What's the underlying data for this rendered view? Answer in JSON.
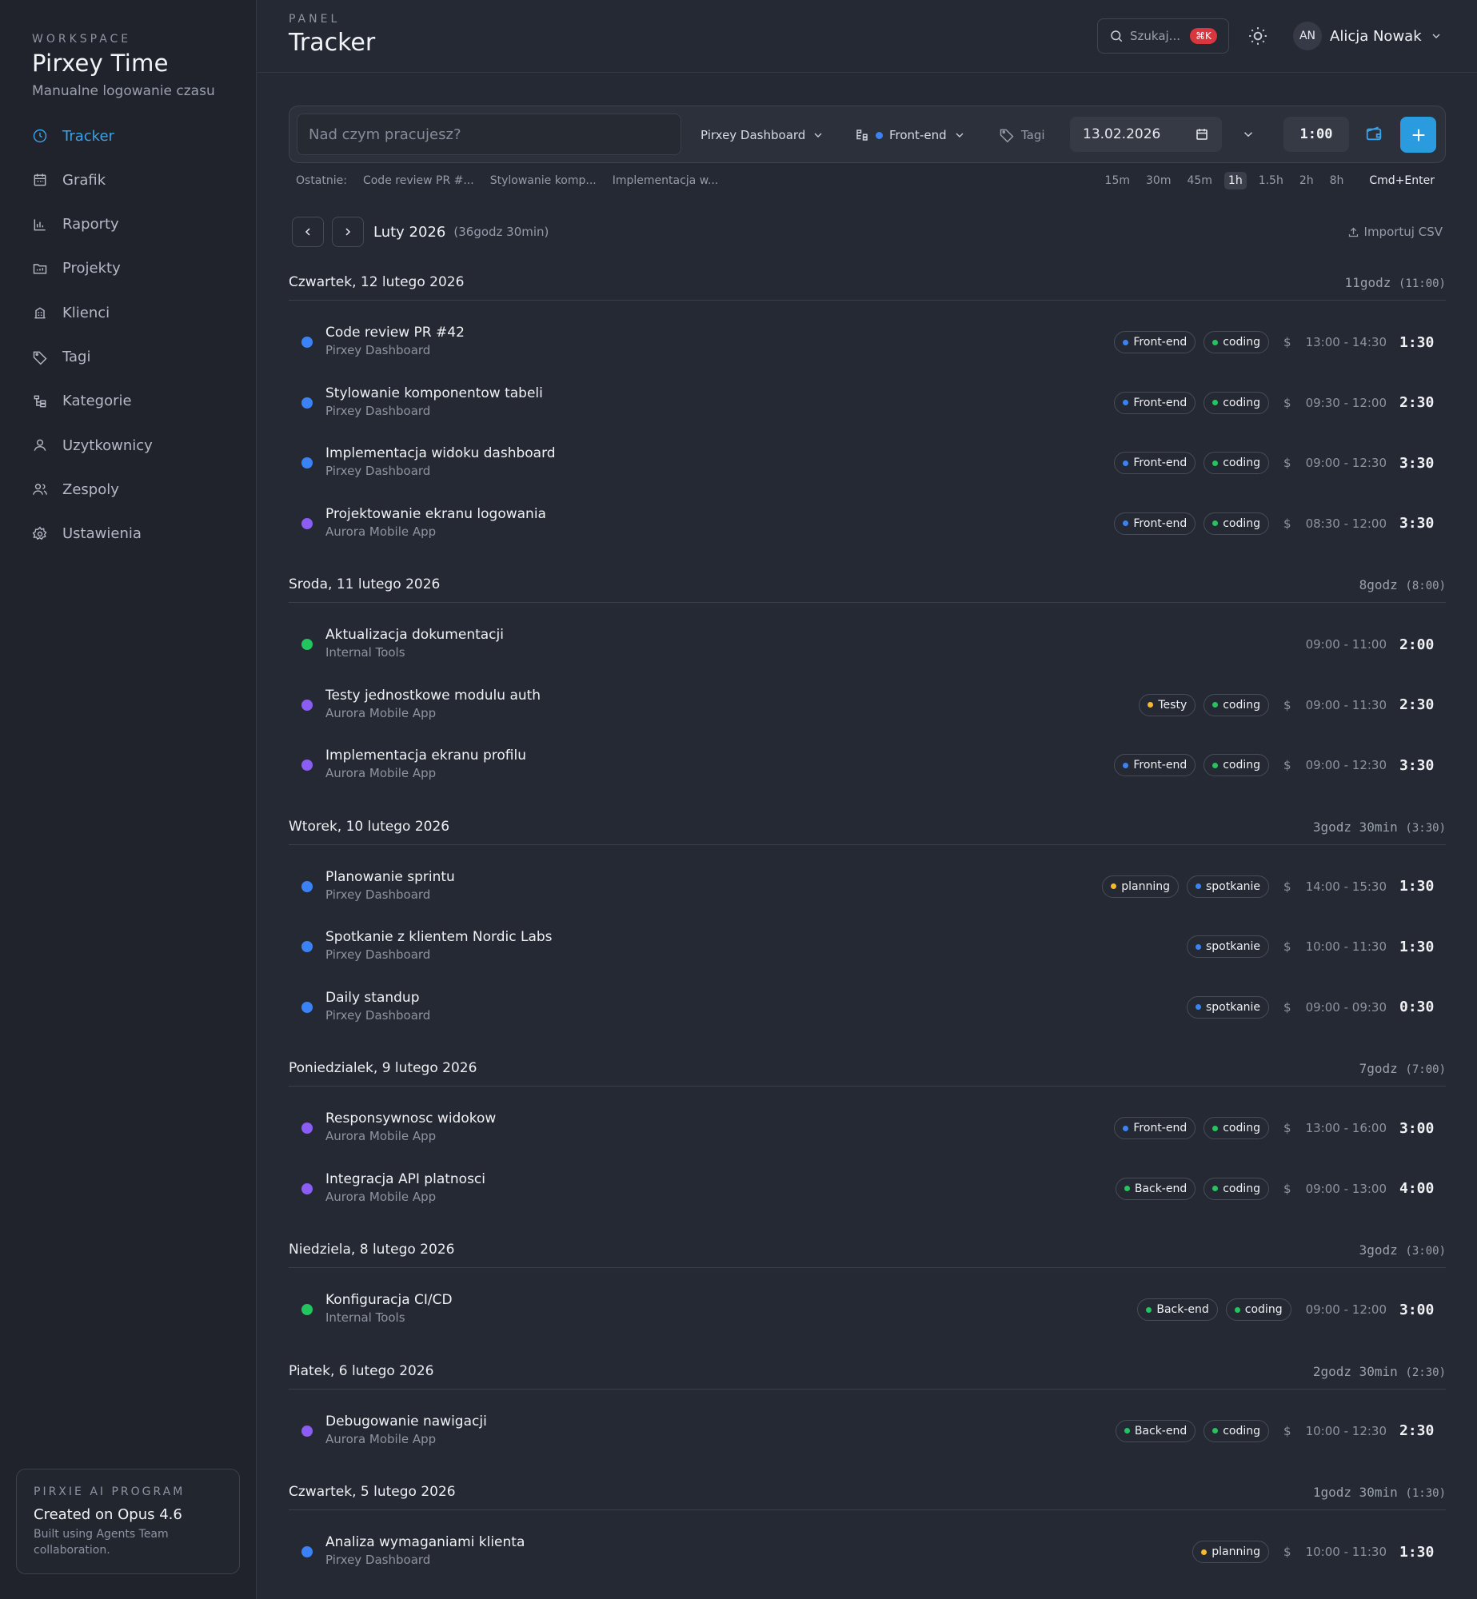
{
  "sidebar": {
    "workspace_label": "WORKSPACE",
    "workspace_name": "Pirxey Time",
    "workspace_sub": "Manualne logowanie czasu",
    "items": [
      {
        "label": "Tracker",
        "icon": "clock-icon",
        "active": true
      },
      {
        "label": "Grafik",
        "icon": "calendar-icon"
      },
      {
        "label": "Raporty",
        "icon": "chart-icon"
      },
      {
        "label": "Projekty",
        "icon": "folder-icon"
      },
      {
        "label": "Klienci",
        "icon": "building-icon"
      },
      {
        "label": "Tagi",
        "icon": "tags-icon"
      },
      {
        "label": "Kategorie",
        "icon": "hierarchy-icon"
      },
      {
        "label": "Uzytkownicy",
        "icon": "user-icon"
      },
      {
        "label": "Zespoly",
        "icon": "team-icon"
      },
      {
        "label": "Ustawienia",
        "icon": "gear-icon"
      }
    ],
    "promo": {
      "label": "PIRXIE AI PROGRAM",
      "title": "Created on Opus 4.6",
      "sub": "Built using Agents Team collaboration."
    }
  },
  "header": {
    "label": "PANEL",
    "title": "Tracker",
    "search_placeholder": "Szukaj...",
    "search_kbd": "⌘K",
    "user_initials": "AN",
    "user_name": "Alicja Nowak"
  },
  "entry_bar": {
    "placeholder": "Nad czym pracujesz?",
    "project": "Pirxey Dashboard",
    "category": "Front-end",
    "category_color": "#3b82f6",
    "tags_label": "Tagi",
    "date": "13.02.2026",
    "duration": "1:00"
  },
  "recent": {
    "label": "Ostatnie:",
    "items": [
      "Code review PR #...",
      "Stylowanie komp...",
      "Implementacja w..."
    ]
  },
  "quick_durations": {
    "options": [
      "15m",
      "30m",
      "45m",
      "1h",
      "1.5h",
      "2h",
      "8h"
    ],
    "selected": "1h",
    "hint": "Cmd+Enter"
  },
  "month": {
    "title": "Luty 2026",
    "total": "(36godz 30min)",
    "import_label": "Importuj CSV"
  },
  "colors": {
    "blue": "#3b82f6",
    "purple": "#8b5cf6",
    "green": "#22c55e",
    "yellow": "#f5b82e",
    "accent": "#2b9be0"
  },
  "days": [
    {
      "title": "Czwartek, 12 lutego 2026",
      "total": "11godz",
      "total_paren": "(11:00)",
      "entries": [
        {
          "title": "Code review PR #42",
          "project": "Pirxey Dashboard",
          "color": "#3b82f6",
          "tags": [
            {
              "name": "Front-end",
              "color": "#3b82f6"
            },
            {
              "name": "coding",
              "color": "#22c55e"
            }
          ],
          "billable": true,
          "range": "13:00 - 14:30",
          "duration": "1:30"
        },
        {
          "title": "Stylowanie komponentow tabeli",
          "project": "Pirxey Dashboard",
          "color": "#3b82f6",
          "tags": [
            {
              "name": "Front-end",
              "color": "#3b82f6"
            },
            {
              "name": "coding",
              "color": "#22c55e"
            }
          ],
          "billable": true,
          "range": "09:30 - 12:00",
          "duration": "2:30"
        },
        {
          "title": "Implementacja widoku dashboard",
          "project": "Pirxey Dashboard",
          "color": "#3b82f6",
          "tags": [
            {
              "name": "Front-end",
              "color": "#3b82f6"
            },
            {
              "name": "coding",
              "color": "#22c55e"
            }
          ],
          "billable": true,
          "range": "09:00 - 12:30",
          "duration": "3:30"
        },
        {
          "title": "Projektowanie ekranu logowania",
          "project": "Aurora Mobile App",
          "color": "#8b5cf6",
          "tags": [
            {
              "name": "Front-end",
              "color": "#3b82f6"
            },
            {
              "name": "coding",
              "color": "#22c55e"
            }
          ],
          "billable": true,
          "range": "08:30 - 12:00",
          "duration": "3:30"
        }
      ]
    },
    {
      "title": "Sroda, 11 lutego 2026",
      "total": "8godz",
      "total_paren": "(8:00)",
      "entries": [
        {
          "title": "Aktualizacja dokumentacji",
          "project": "Internal Tools",
          "color": "#22c55e",
          "tags": [],
          "billable": false,
          "range": "09:00 - 11:00",
          "duration": "2:00"
        },
        {
          "title": "Testy jednostkowe modulu auth",
          "project": "Aurora Mobile App",
          "color": "#8b5cf6",
          "tags": [
            {
              "name": "Testy",
              "color": "#f5b82e"
            },
            {
              "name": "coding",
              "color": "#22c55e"
            }
          ],
          "billable": true,
          "range": "09:00 - 11:30",
          "duration": "2:30"
        },
        {
          "title": "Implementacja ekranu profilu",
          "project": "Aurora Mobile App",
          "color": "#8b5cf6",
          "tags": [
            {
              "name": "Front-end",
              "color": "#3b82f6"
            },
            {
              "name": "coding",
              "color": "#22c55e"
            }
          ],
          "billable": true,
          "range": "09:00 - 12:30",
          "duration": "3:30"
        }
      ]
    },
    {
      "title": "Wtorek, 10 lutego 2026",
      "total": "3godz 30min",
      "total_paren": "(3:30)",
      "entries": [
        {
          "title": "Planowanie sprintu",
          "project": "Pirxey Dashboard",
          "color": "#3b82f6",
          "tags": [
            {
              "name": "planning",
              "color": "#f5b82e"
            },
            {
              "name": "spotkanie",
              "color": "#3b82f6"
            }
          ],
          "billable": true,
          "range": "14:00 - 15:30",
          "duration": "1:30"
        },
        {
          "title": "Spotkanie z klientem Nordic Labs",
          "project": "Pirxey Dashboard",
          "color": "#3b82f6",
          "tags": [
            {
              "name": "spotkanie",
              "color": "#3b82f6"
            }
          ],
          "billable": true,
          "range": "10:00 - 11:30",
          "duration": "1:30"
        },
        {
          "title": "Daily standup",
          "project": "Pirxey Dashboard",
          "color": "#3b82f6",
          "tags": [
            {
              "name": "spotkanie",
              "color": "#3b82f6"
            }
          ],
          "billable": true,
          "range": "09:00 - 09:30",
          "duration": "0:30"
        }
      ]
    },
    {
      "title": "Poniedzialek, 9 lutego 2026",
      "total": "7godz",
      "total_paren": "(7:00)",
      "entries": [
        {
          "title": "Responsywnosc widokow",
          "project": "Aurora Mobile App",
          "color": "#8b5cf6",
          "tags": [
            {
              "name": "Front-end",
              "color": "#3b82f6"
            },
            {
              "name": "coding",
              "color": "#22c55e"
            }
          ],
          "billable": true,
          "range": "13:00 - 16:00",
          "duration": "3:00"
        },
        {
          "title": "Integracja API platnosci",
          "project": "Aurora Mobile App",
          "color": "#8b5cf6",
          "tags": [
            {
              "name": "Back-end",
              "color": "#22c55e"
            },
            {
              "name": "coding",
              "color": "#22c55e"
            }
          ],
          "billable": true,
          "range": "09:00 - 13:00",
          "duration": "4:00"
        }
      ]
    },
    {
      "title": "Niedziela, 8 lutego 2026",
      "total": "3godz",
      "total_paren": "(3:00)",
      "entries": [
        {
          "title": "Konfiguracja CI/CD",
          "project": "Internal Tools",
          "color": "#22c55e",
          "tags": [
            {
              "name": "Back-end",
              "color": "#22c55e"
            },
            {
              "name": "coding",
              "color": "#22c55e"
            }
          ],
          "billable": false,
          "range": "09:00 - 12:00",
          "duration": "3:00"
        }
      ]
    },
    {
      "title": "Piatek, 6 lutego 2026",
      "total": "2godz 30min",
      "total_paren": "(2:30)",
      "entries": [
        {
          "title": "Debugowanie nawigacji",
          "project": "Aurora Mobile App",
          "color": "#8b5cf6",
          "tags": [
            {
              "name": "Back-end",
              "color": "#22c55e"
            },
            {
              "name": "coding",
              "color": "#22c55e"
            }
          ],
          "billable": true,
          "range": "10:00 - 12:30",
          "duration": "2:30"
        }
      ]
    },
    {
      "title": "Czwartek, 5 lutego 2026",
      "total": "1godz 30min",
      "total_paren": "(1:30)",
      "entries": [
        {
          "title": "Analiza wymaganiami klienta",
          "project": "Pirxey Dashboard",
          "color": "#3b82f6",
          "tags": [
            {
              "name": "planning",
              "color": "#f5b82e"
            }
          ],
          "billable": true,
          "range": "10:00 - 11:30",
          "duration": "1:30"
        }
      ]
    }
  ]
}
